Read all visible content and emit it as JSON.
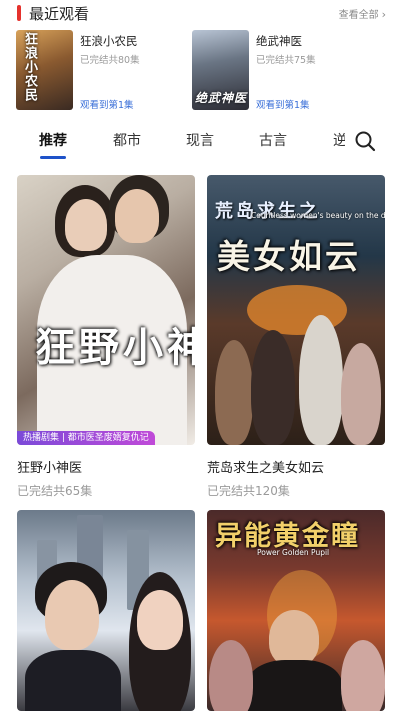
{
  "recent": {
    "title": "最近观看",
    "see_all": "查看全部",
    "items": [
      {
        "name": "狂浪小农民",
        "status": "已完结共80集",
        "progress": "观看到第1集",
        "cover_text": "狂浪小农民"
      },
      {
        "name": "绝武神医",
        "status": "已完结共75集",
        "progress": "观看到第1集",
        "cover_text": "绝武神医"
      }
    ]
  },
  "tabs": [
    {
      "label": "推荐",
      "active": true
    },
    {
      "label": "都市",
      "active": false
    },
    {
      "label": "现言",
      "active": false
    },
    {
      "label": "古言",
      "active": false
    },
    {
      "label": "逆",
      "active": false
    }
  ],
  "cards": [
    {
      "name": "狂野小神医",
      "status": "已完结共65集",
      "poster_title": "狂野小神医",
      "tag": "热播剧集 | 都市医圣废婿复仇记"
    },
    {
      "name": "荒岛求生之美女如云",
      "status": "已完结共120集",
      "poster_title": "美女如云",
      "poster_sub": "荒岛求生之",
      "poster_en": "Countless women's beauty on the desert island"
    },
    {
      "name": "",
      "status": ""
    },
    {
      "name": "",
      "status": "",
      "poster_title": "异能黄金瞳",
      "poster_en": "Power Golden Pupil"
    }
  ],
  "colors": {
    "accent_red": "#e5322d",
    "tab_indicator": "#1e52c9",
    "progress_link": "#3a6fd8"
  },
  "icons": {
    "search": "search-icon",
    "chevron": "chevron-right-icon"
  }
}
